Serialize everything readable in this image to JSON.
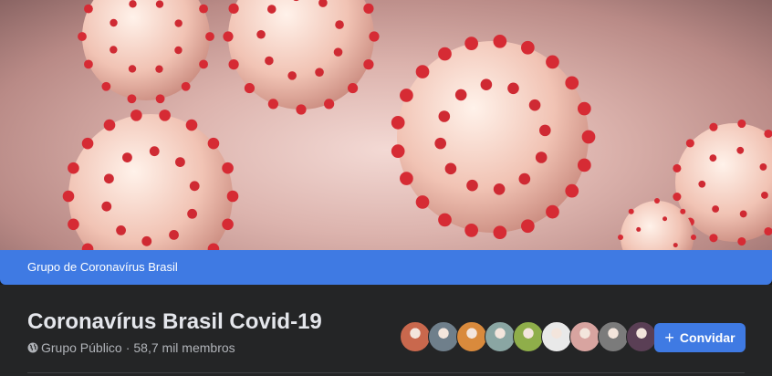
{
  "cover": {
    "image_description_icon": "coronavirus-cover-image"
  },
  "banner": {
    "label": "Grupo de Coronavírus Brasil"
  },
  "group": {
    "title": "Coronavírus Brasil Covid-19",
    "privacy": "Grupo Público",
    "separator": "·",
    "members": "58,7 mil membros"
  },
  "member_avatars": [
    {
      "color": "#c9684d"
    },
    {
      "color": "#6f7f8b"
    },
    {
      "color": "#d98a3c"
    },
    {
      "color": "#8aa6a3"
    },
    {
      "color": "#8fae4a"
    },
    {
      "color": "#e9e9e9"
    },
    {
      "color": "#d8a4a0"
    },
    {
      "color": "#7b7b7b"
    },
    {
      "color": "#5a3f55"
    }
  ],
  "actions": {
    "invite_label": "Convidar",
    "invite_icon": "plus-icon"
  },
  "colors": {
    "accent": "#3f7ae3",
    "header_bg": "#242526",
    "title_text": "#e4e6eb",
    "muted_text": "#b0b3b8"
  }
}
